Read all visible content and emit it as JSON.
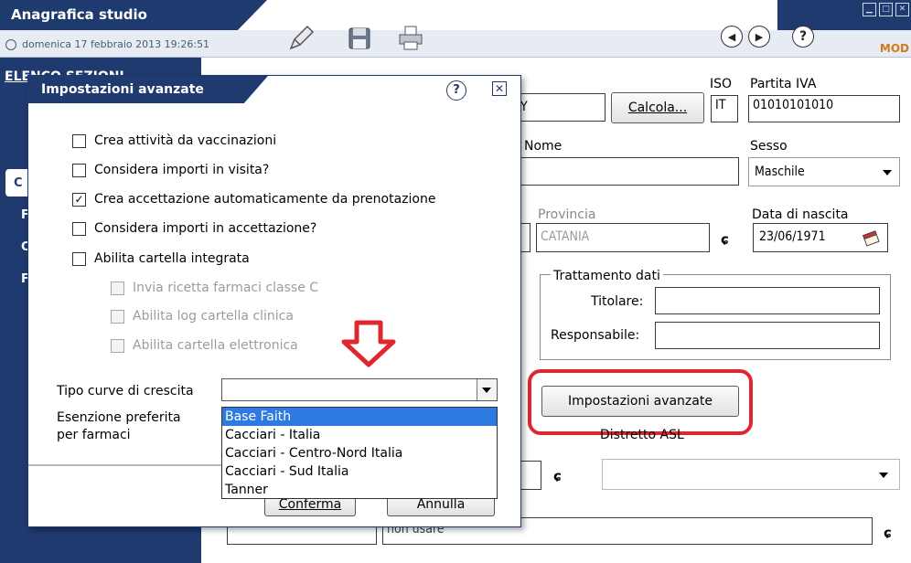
{
  "window": {
    "title": "Anagrafica studio",
    "datetime": "domenica 17 febbraio 2013 19:26:51",
    "mode": "MOD"
  },
  "toolbar": {
    "icons": [
      "edit-pen-icon",
      "save-floppy-icon",
      "printer-icon"
    ],
    "nav": [
      "back-circle-icon",
      "forward-circle-icon",
      "help-circle-icon"
    ],
    "help_glyph": "?"
  },
  "sidebar": {
    "heading": "ELENCO SEZIONI",
    "letters": [
      "C",
      "F",
      "C",
      "F"
    ]
  },
  "form": {
    "cf_partial": "Y",
    "calcola_label": "Calcola...",
    "iso_label": "ISO",
    "iso_value": "IT",
    "piva_label": "Partita IVA",
    "piva_value": "01010101010",
    "nome_label": "Nome",
    "sesso_label": "Sesso",
    "sesso_value": "Maschile",
    "provincia_label": "Provincia",
    "provincia_value": "CATANIA",
    "nascita_label": "Data di nascita",
    "nascita_value": "23/06/1971",
    "trattamento_title": "Trattamento dati",
    "titolare_label": "Titolare:",
    "responsabile_label": "Responsabile:",
    "impostazioni_button": "Impostazioni avanzate",
    "distretto_label": "Distretto ASL",
    "bottom_partial": "non usare"
  },
  "dialog": {
    "title": "Impostazioni avanzate",
    "options": [
      {
        "label": "Crea attività da vaccinazioni",
        "checked": false,
        "enabled": true
      },
      {
        "label": "Considera importi in visita?",
        "checked": false,
        "enabled": true
      },
      {
        "label": "Crea accettazione automaticamente da prenotazione",
        "checked": true,
        "enabled": true
      },
      {
        "label": "Considera importi in accettazione?",
        "checked": false,
        "enabled": true
      },
      {
        "label": "Abilita cartella integrata",
        "checked": false,
        "enabled": true
      },
      {
        "label": "Invia ricetta farmaci classe C",
        "checked": false,
        "enabled": false
      },
      {
        "label": "Abilita log cartella clinica",
        "checked": false,
        "enabled": false
      },
      {
        "label": "Abilita cartella elettronica",
        "checked": false,
        "enabled": false
      }
    ],
    "curve_label": "Tipo curve di crescita",
    "curve_value": "",
    "esenzione_label_1": "Esenzione preferita",
    "esenzione_label_2": "per farmaci",
    "curve_options": [
      "Base Faith",
      "Cacciari - Italia",
      "Cacciari - Centro-Nord Italia",
      "Cacciari - Sud Italia",
      "Tanner"
    ],
    "selected_option": "Base Faith",
    "conferma_label": "Conferma",
    "annulla_label": "Annulla"
  },
  "colors": {
    "navy": "#1f3a6e",
    "highlight_red": "#e0262e",
    "selection_blue": "#2d7ae0",
    "mode_orange": "#d07a1a"
  }
}
